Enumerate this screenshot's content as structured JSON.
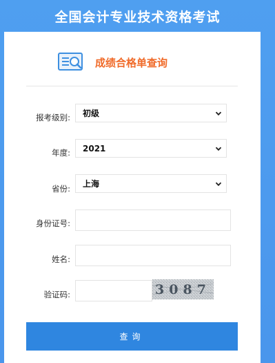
{
  "header": {
    "title": "全国会计专业技术资格考试"
  },
  "logo": {
    "text": "成绩合格单查询",
    "icon": "document-search-icon"
  },
  "form": {
    "level_label": "报考级别:",
    "level_value": "初级",
    "year_label": "年度:",
    "year_value": "2021",
    "province_label": "省份:",
    "province_value": "上海",
    "id_label": "身份证号:",
    "id_value": "",
    "name_label": "姓名:",
    "name_value": "",
    "captcha_label": "验证码:",
    "captcha_value": "",
    "captcha_code": "3087"
  },
  "actions": {
    "query_label": "查询"
  },
  "colors": {
    "header_blue": "#4f9ff0",
    "accent_orange": "#f06b2a",
    "button_blue": "#2f86e0"
  }
}
